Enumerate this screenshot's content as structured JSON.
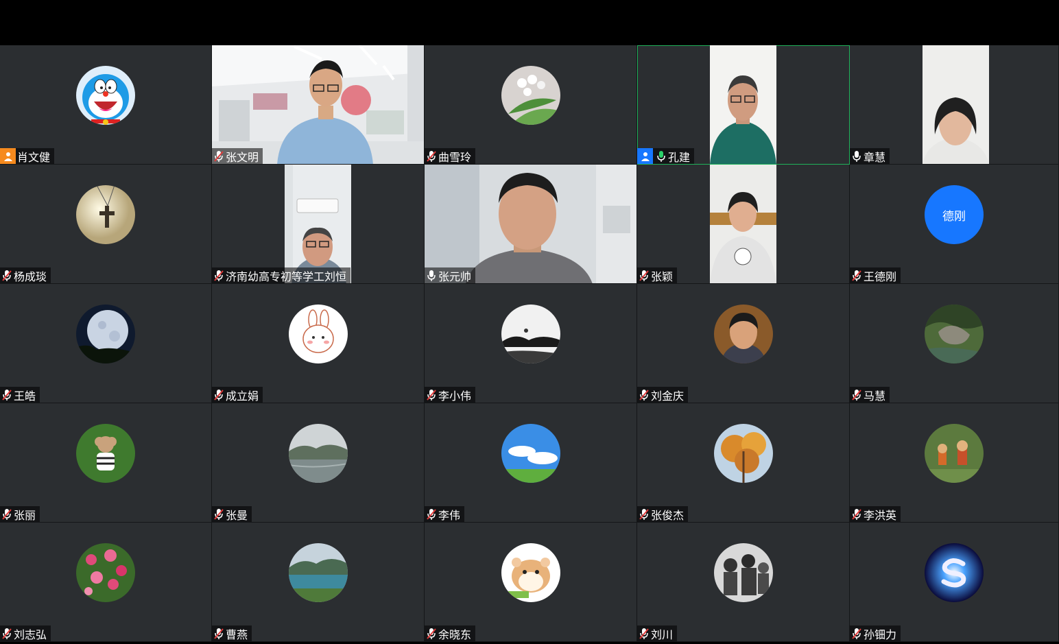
{
  "participants": [
    {
      "name": "肖文健",
      "avatar": "doraemon",
      "host_badge": "orange",
      "mic": "none"
    },
    {
      "name": "张文明",
      "video": "classroom",
      "mic": "muted"
    },
    {
      "name": "曲雪玲",
      "avatar": "lily-flower",
      "mic": "muted"
    },
    {
      "name": "孔建",
      "video": "man-green-shirt",
      "host_badge": "blue",
      "mic": "active",
      "active": true
    },
    {
      "name": "章慧",
      "video": "woman-white-wall",
      "mic": "on"
    },
    {
      "name": "杨成琰",
      "avatar": "cross-pendant",
      "mic": "muted"
    },
    {
      "name": "济南幼高专初等学工刘恒",
      "video": "man-glasses-ac",
      "mic": "muted"
    },
    {
      "name": "张元帅",
      "video": "man-closeup",
      "mic": "on"
    },
    {
      "name": "张颖",
      "video": "woman-seated",
      "mic": "muted"
    },
    {
      "name": "王德刚",
      "avatar_text": "德刚",
      "mic": "muted"
    },
    {
      "name": "王皓",
      "avatar": "moon",
      "mic": "muted"
    },
    {
      "name": "成立娟",
      "avatar": "bunny",
      "mic": "muted"
    },
    {
      "name": "李小伟",
      "avatar": "ink-landscape",
      "mic": "muted"
    },
    {
      "name": "刘金庆",
      "avatar": "man-portrait",
      "mic": "muted"
    },
    {
      "name": "马慧",
      "avatar": "gorge",
      "mic": "muted"
    },
    {
      "name": "张丽",
      "avatar": "poodle",
      "mic": "muted"
    },
    {
      "name": "张曼",
      "avatar": "lake-mist",
      "mic": "muted"
    },
    {
      "name": "李伟",
      "avatar": "blue-sky",
      "mic": "muted"
    },
    {
      "name": "张俊杰",
      "avatar": "autumn-tree",
      "mic": "muted"
    },
    {
      "name": "李洪英",
      "avatar": "garden-figures",
      "mic": "muted"
    },
    {
      "name": "刘志弘",
      "avatar": "roses",
      "mic": "muted"
    },
    {
      "name": "曹燕",
      "avatar": "mountain-lake",
      "mic": "muted"
    },
    {
      "name": "余晓东",
      "avatar": "hamster",
      "mic": "muted"
    },
    {
      "name": "刘川",
      "avatar": "soldiers-bw",
      "mic": "muted"
    },
    {
      "name": "孙钿力",
      "avatar": "star-s-logo",
      "mic": "muted"
    }
  ],
  "colors": {
    "tile_bg": "#2b2e31",
    "active_border": "#1fb25a",
    "host_blue": "#1777ff",
    "host_orange": "#f68a1e",
    "avatar_text_bg": "#1777ff"
  }
}
